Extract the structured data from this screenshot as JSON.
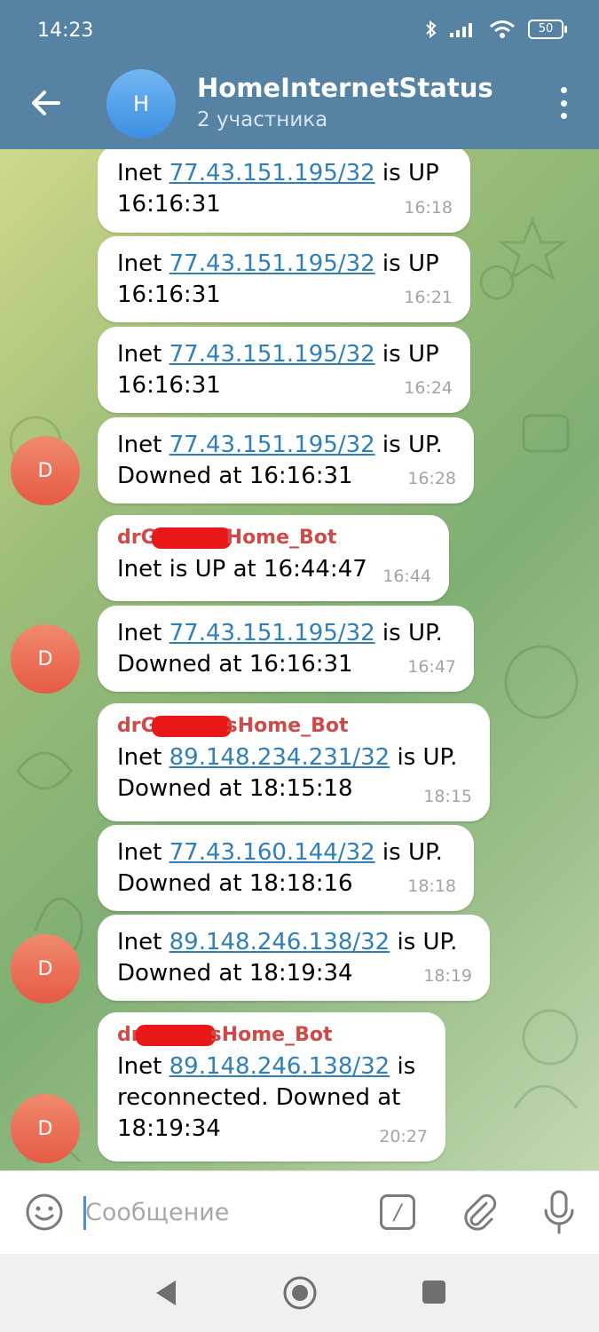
{
  "status_bar": {
    "time": "14:23",
    "battery": "50"
  },
  "header": {
    "avatar_letter": "H",
    "title": "HomeInternetStatus",
    "subtitle": "2 участника"
  },
  "messages": [
    {
      "lines": [
        [
          "Inet ",
          "77.43.151.195/32",
          " is UP"
        ],
        [
          "16:16:31"
        ]
      ],
      "time": "16:18"
    },
    {
      "lines": [
        [
          "Inet ",
          "77.43.151.195/32",
          " is UP"
        ],
        [
          "16:16:31"
        ]
      ],
      "time": "16:21"
    },
    {
      "lines": [
        [
          "Inet ",
          "77.43.151.195/32",
          " is UP"
        ],
        [
          "16:16:31"
        ]
      ],
      "time": "16:24"
    },
    {
      "lines": [
        [
          "Inet ",
          "77.43.151.195/32",
          " is UP."
        ],
        [
          "Downed at 16:16:31"
        ]
      ],
      "time": "16:28",
      "avatar": "D"
    },
    {
      "sender": [
        "drG",
        "Home_Bot"
      ],
      "lines": [
        [
          "Inet is UP at 16:44:47"
        ]
      ],
      "time": "16:44"
    },
    {
      "lines": [
        [
          "Inet ",
          "77.43.151.195/32",
          " is UP."
        ],
        [
          "Downed at 16:16:31"
        ]
      ],
      "time": "16:47",
      "avatar": "D"
    },
    {
      "sender": [
        "drG",
        "sHome_Bot"
      ],
      "lines": [
        [
          "Inet ",
          "89.148.234.231/32",
          " is UP."
        ],
        [
          "Downed at 18:15:18"
        ]
      ],
      "time": "18:15"
    },
    {
      "lines": [
        [
          "Inet ",
          "77.43.160.144/32",
          " is UP."
        ],
        [
          "Downed at 18:18:16"
        ]
      ],
      "time": "18:18"
    },
    {
      "lines": [
        [
          "Inet ",
          "89.148.246.138/32",
          " is UP."
        ],
        [
          "Downed at 18:19:34"
        ]
      ],
      "time": "18:19",
      "avatar": "D"
    },
    {
      "sender": [
        "dr",
        "sHome_Bot"
      ],
      "lines": [
        [
          "Inet ",
          "89.148.246.138/32",
          " is"
        ],
        [
          "reconnected. Downed at"
        ],
        [
          "18:19:34"
        ]
      ],
      "time": "20:27",
      "avatar": "D"
    }
  ],
  "input": {
    "placeholder": "Сообщение",
    "value": "",
    "command_label": "/"
  }
}
